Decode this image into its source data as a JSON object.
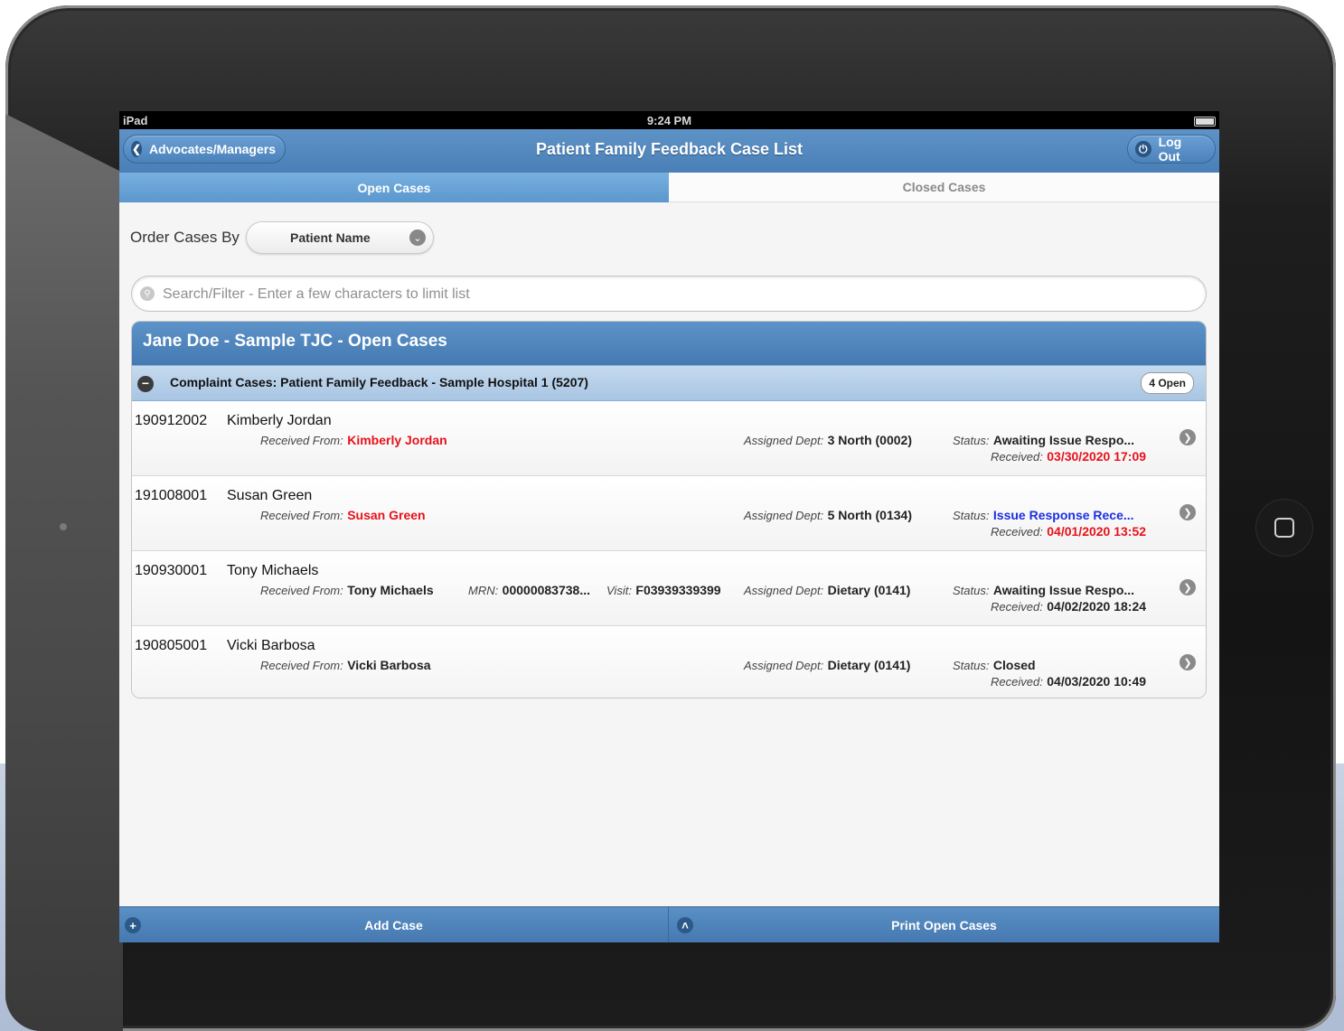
{
  "status_bar": {
    "carrier": "iPad",
    "time": "9:24 PM"
  },
  "header": {
    "back_label": "Advocates/Managers",
    "title": "Patient Family Feedback Case List",
    "logout_label": "Log Out"
  },
  "tabs": {
    "open": "Open Cases",
    "closed": "Closed Cases"
  },
  "order": {
    "label": "Order Cases By",
    "value": "Patient Name"
  },
  "search": {
    "placeholder": "Search/Filter - Enter a few characters to limit list",
    "value": ""
  },
  "list": {
    "title": "Jane Doe - Sample TJC - Open Cases",
    "group": {
      "title": "Complaint Cases:  Patient Family Feedback - Sample Hospital 1 (5207)",
      "badge": "4 Open"
    },
    "labels": {
      "received_from": "Received From:",
      "mrn": "MRN:",
      "visit": "Visit:",
      "assigned_dept": "Assigned Dept:",
      "status": "Status:",
      "received": "Received:"
    },
    "cases": [
      {
        "number": "190912002",
        "name": "Kimberly Jordan",
        "received_from": "Kimberly Jordan",
        "dept": "3 North (0002)",
        "status": "Awaiting Issue Respo...",
        "received": "03/30/2020 17:09"
      },
      {
        "number": "191008001",
        "name": "Susan Green",
        "received_from": "Susan Green",
        "dept": "5 North (0134)",
        "status": "Issue Response Rece...",
        "received": "04/01/2020 13:52"
      },
      {
        "number": "190930001",
        "name": "Tony Michaels",
        "received_from": "Tony Michaels",
        "mrn": "00000083738...",
        "visit": "F03939339399",
        "dept": "Dietary (0141)",
        "status": "Awaiting Issue Respo...",
        "received": "04/02/2020 18:24"
      },
      {
        "number": "190805001",
        "name": "Vicki Barbosa",
        "received_from": "Vicki Barbosa",
        "dept": "Dietary (0141)",
        "status": "Closed",
        "received": "04/03/2020 10:49"
      }
    ]
  },
  "footer": {
    "add_label": "Add Case",
    "print_label": "Print Open Cases"
  },
  "colors": {
    "header_blue": "#4a7fb7",
    "alert_red": "#e8111b",
    "status_blue": "#1d2ee0"
  }
}
